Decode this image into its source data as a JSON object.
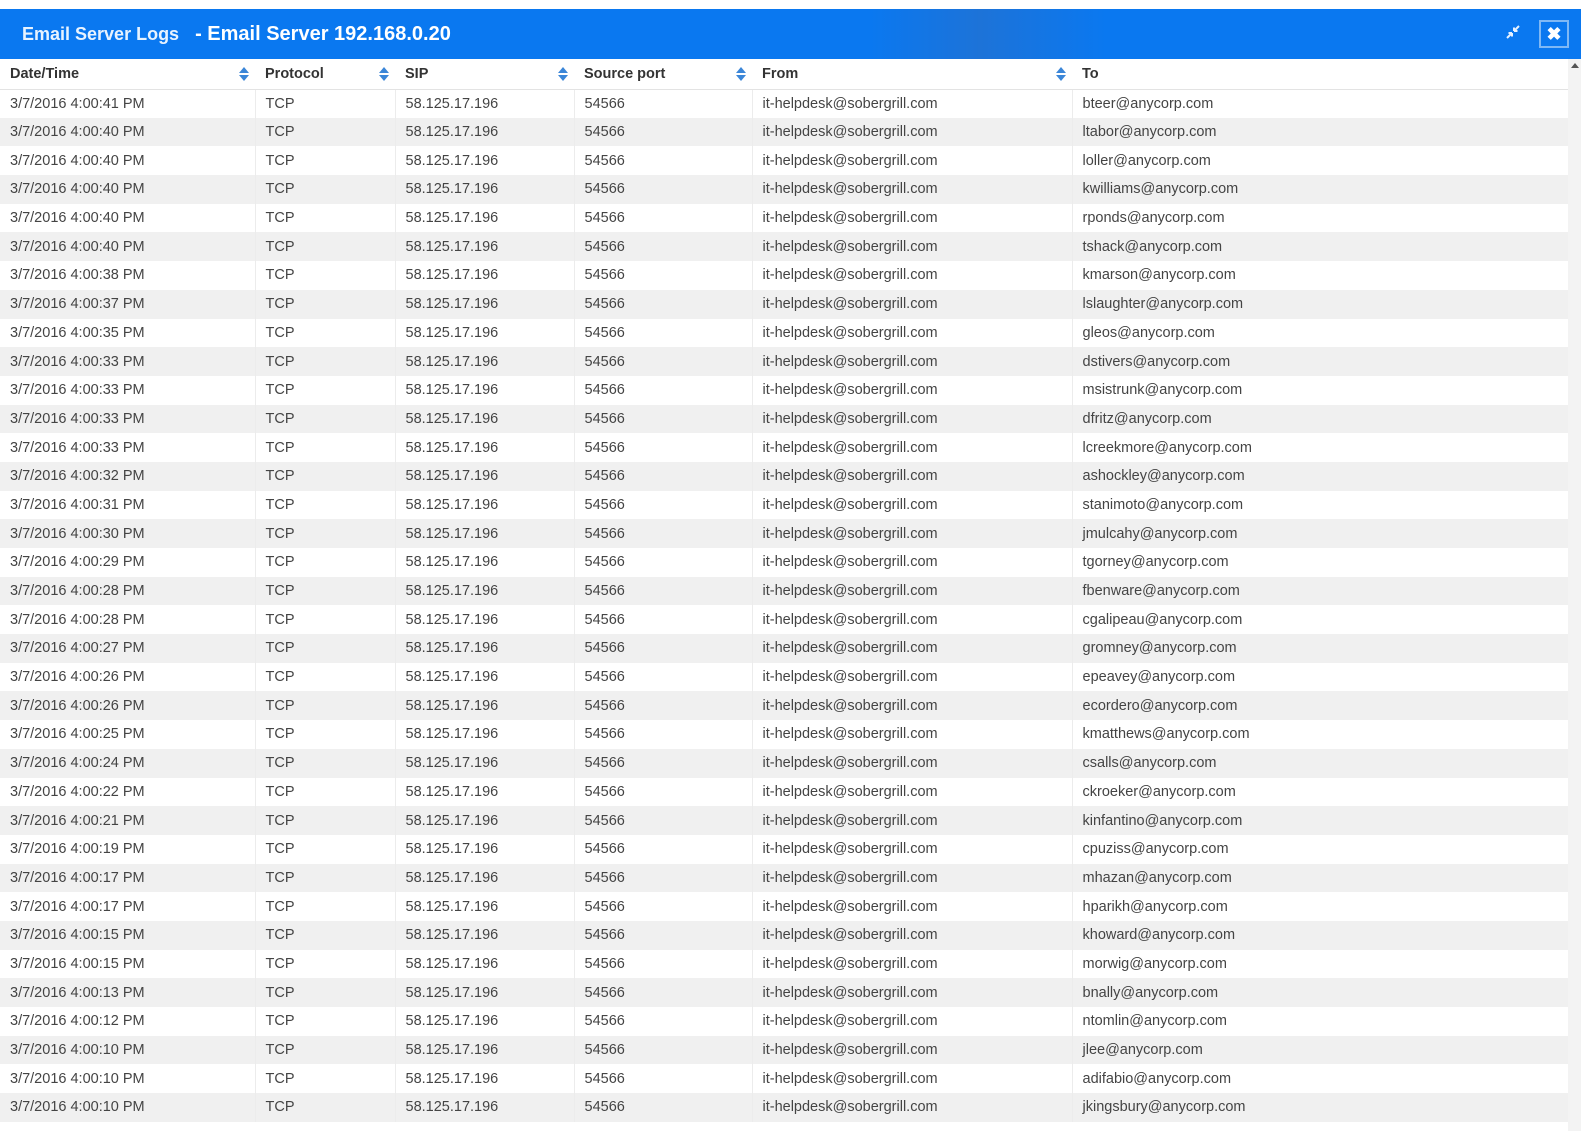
{
  "window": {
    "title": "Email Server Logs",
    "subtitle": "- Email Server 192.168.0.20",
    "restore_icon": "compress-arrows-icon",
    "close_icon": "close-x-icon",
    "close_glyph": "✖"
  },
  "columns": [
    {
      "label": "Date/Time",
      "sortable": true
    },
    {
      "label": "Protocol",
      "sortable": true
    },
    {
      "label": "SIP",
      "sortable": true
    },
    {
      "label": "Source port",
      "sortable": true
    },
    {
      "label": "From",
      "sortable": true
    },
    {
      "label": "To",
      "sortable": false
    }
  ],
  "rows": [
    [
      "3/7/2016 4:00:41 PM",
      "TCP",
      "58.125.17.196",
      "54566",
      "it-helpdesk@sobergrill.com",
      "bteer@anycorp.com"
    ],
    [
      "3/7/2016 4:00:40 PM",
      "TCP",
      "58.125.17.196",
      "54566",
      "it-helpdesk@sobergrill.com",
      "ltabor@anycorp.com"
    ],
    [
      "3/7/2016 4:00:40 PM",
      "TCP",
      "58.125.17.196",
      "54566",
      "it-helpdesk@sobergrill.com",
      "loller@anycorp.com"
    ],
    [
      "3/7/2016 4:00:40 PM",
      "TCP",
      "58.125.17.196",
      "54566",
      "it-helpdesk@sobergrill.com",
      "kwilliams@anycorp.com"
    ],
    [
      "3/7/2016 4:00:40 PM",
      "TCP",
      "58.125.17.196",
      "54566",
      "it-helpdesk@sobergrill.com",
      "rponds@anycorp.com"
    ],
    [
      "3/7/2016 4:00:40 PM",
      "TCP",
      "58.125.17.196",
      "54566",
      "it-helpdesk@sobergrill.com",
      "tshack@anycorp.com"
    ],
    [
      "3/7/2016 4:00:38 PM",
      "TCP",
      "58.125.17.196",
      "54566",
      "it-helpdesk@sobergrill.com",
      "kmarson@anycorp.com"
    ],
    [
      "3/7/2016 4:00:37 PM",
      "TCP",
      "58.125.17.196",
      "54566",
      "it-helpdesk@sobergrill.com",
      "lslaughter@anycorp.com"
    ],
    [
      "3/7/2016 4:00:35 PM",
      "TCP",
      "58.125.17.196",
      "54566",
      "it-helpdesk@sobergrill.com",
      "gleos@anycorp.com"
    ],
    [
      "3/7/2016 4:00:33 PM",
      "TCP",
      "58.125.17.196",
      "54566",
      "it-helpdesk@sobergrill.com",
      "dstivers@anycorp.com"
    ],
    [
      "3/7/2016 4:00:33 PM",
      "TCP",
      "58.125.17.196",
      "54566",
      "it-helpdesk@sobergrill.com",
      "msistrunk@anycorp.com"
    ],
    [
      "3/7/2016 4:00:33 PM",
      "TCP",
      "58.125.17.196",
      "54566",
      "it-helpdesk@sobergrill.com",
      "dfritz@anycorp.com"
    ],
    [
      "3/7/2016 4:00:33 PM",
      "TCP",
      "58.125.17.196",
      "54566",
      "it-helpdesk@sobergrill.com",
      "lcreekmore@anycorp.com"
    ],
    [
      "3/7/2016 4:00:32 PM",
      "TCP",
      "58.125.17.196",
      "54566",
      "it-helpdesk@sobergrill.com",
      "ashockley@anycorp.com"
    ],
    [
      "3/7/2016 4:00:31 PM",
      "TCP",
      "58.125.17.196",
      "54566",
      "it-helpdesk@sobergrill.com",
      "stanimoto@anycorp.com"
    ],
    [
      "3/7/2016 4:00:30 PM",
      "TCP",
      "58.125.17.196",
      "54566",
      "it-helpdesk@sobergrill.com",
      "jmulcahy@anycorp.com"
    ],
    [
      "3/7/2016 4:00:29 PM",
      "TCP",
      "58.125.17.196",
      "54566",
      "it-helpdesk@sobergrill.com",
      "tgorney@anycorp.com"
    ],
    [
      "3/7/2016 4:00:28 PM",
      "TCP",
      "58.125.17.196",
      "54566",
      "it-helpdesk@sobergrill.com",
      "fbenware@anycorp.com"
    ],
    [
      "3/7/2016 4:00:28 PM",
      "TCP",
      "58.125.17.196",
      "54566",
      "it-helpdesk@sobergrill.com",
      "cgalipeau@anycorp.com"
    ],
    [
      "3/7/2016 4:00:27 PM",
      "TCP",
      "58.125.17.196",
      "54566",
      "it-helpdesk@sobergrill.com",
      "gromney@anycorp.com"
    ],
    [
      "3/7/2016 4:00:26 PM",
      "TCP",
      "58.125.17.196",
      "54566",
      "it-helpdesk@sobergrill.com",
      "epeavey@anycorp.com"
    ],
    [
      "3/7/2016 4:00:26 PM",
      "TCP",
      "58.125.17.196",
      "54566",
      "it-helpdesk@sobergrill.com",
      "ecordero@anycorp.com"
    ],
    [
      "3/7/2016 4:00:25 PM",
      "TCP",
      "58.125.17.196",
      "54566",
      "it-helpdesk@sobergrill.com",
      "kmatthews@anycorp.com"
    ],
    [
      "3/7/2016 4:00:24 PM",
      "TCP",
      "58.125.17.196",
      "54566",
      "it-helpdesk@sobergrill.com",
      "csalls@anycorp.com"
    ],
    [
      "3/7/2016 4:00:22 PM",
      "TCP",
      "58.125.17.196",
      "54566",
      "it-helpdesk@sobergrill.com",
      "ckroeker@anycorp.com"
    ],
    [
      "3/7/2016 4:00:21 PM",
      "TCP",
      "58.125.17.196",
      "54566",
      "it-helpdesk@sobergrill.com",
      "kinfantino@anycorp.com"
    ],
    [
      "3/7/2016 4:00:19 PM",
      "TCP",
      "58.125.17.196",
      "54566",
      "it-helpdesk@sobergrill.com",
      "cpuziss@anycorp.com"
    ],
    [
      "3/7/2016 4:00:17 PM",
      "TCP",
      "58.125.17.196",
      "54566",
      "it-helpdesk@sobergrill.com",
      "mhazan@anycorp.com"
    ],
    [
      "3/7/2016 4:00:17 PM",
      "TCP",
      "58.125.17.196",
      "54566",
      "it-helpdesk@sobergrill.com",
      "hparikh@anycorp.com"
    ],
    [
      "3/7/2016 4:00:15 PM",
      "TCP",
      "58.125.17.196",
      "54566",
      "it-helpdesk@sobergrill.com",
      "khoward@anycorp.com"
    ],
    [
      "3/7/2016 4:00:15 PM",
      "TCP",
      "58.125.17.196",
      "54566",
      "it-helpdesk@sobergrill.com",
      "morwig@anycorp.com"
    ],
    [
      "3/7/2016 4:00:13 PM",
      "TCP",
      "58.125.17.196",
      "54566",
      "it-helpdesk@sobergrill.com",
      "bnally@anycorp.com"
    ],
    [
      "3/7/2016 4:00:12 PM",
      "TCP",
      "58.125.17.196",
      "54566",
      "it-helpdesk@sobergrill.com",
      "ntomlin@anycorp.com"
    ],
    [
      "3/7/2016 4:00:10 PM",
      "TCP",
      "58.125.17.196",
      "54566",
      "it-helpdesk@sobergrill.com",
      "jlee@anycorp.com"
    ],
    [
      "3/7/2016 4:00:10 PM",
      "TCP",
      "58.125.17.196",
      "54566",
      "it-helpdesk@sobergrill.com",
      "adifabio@anycorp.com"
    ],
    [
      "3/7/2016 4:00:10 PM",
      "TCP",
      "58.125.17.196",
      "54566",
      "it-helpdesk@sobergrill.com",
      "jkingsbury@anycorp.com"
    ]
  ],
  "colors": {
    "titlebar": "#0a78f0",
    "sort_arrow": "#3b86d8",
    "row_alt": "#f0f0f0"
  }
}
